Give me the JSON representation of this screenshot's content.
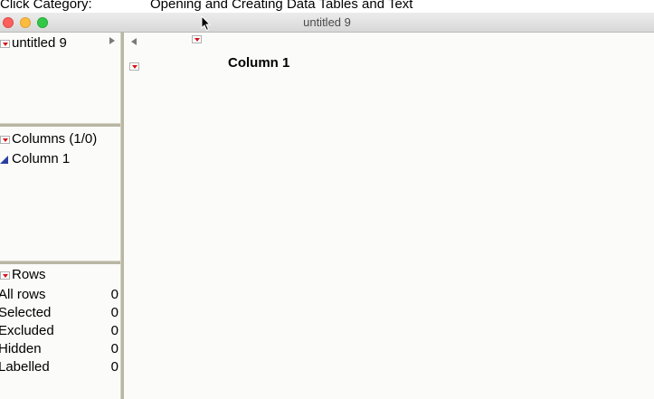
{
  "caption": {
    "category_label": "Click Category:",
    "topic": "Opening and Creating Data Tables and Text"
  },
  "window": {
    "title": "untitled 9"
  },
  "table_panel": {
    "name": "untitled 9"
  },
  "columns_panel": {
    "header": "Columns (1/0)",
    "items": [
      {
        "name": "Column 1",
        "icon": "continuous-column-icon"
      }
    ]
  },
  "rows_panel": {
    "header": "Rows",
    "items": [
      {
        "label": "All rows",
        "value": "0"
      },
      {
        "label": "Selected",
        "value": "0"
      },
      {
        "label": "Excluded",
        "value": "0"
      },
      {
        "label": "Hidden",
        "value": "0"
      },
      {
        "label": "Labelled",
        "value": "0"
      }
    ]
  },
  "grid": {
    "columns": [
      "Column 1"
    ]
  },
  "colors": {
    "accent_red": "#d3151a",
    "splitter": "#b9b7a4",
    "continuous_icon": "#2b3f9e"
  }
}
